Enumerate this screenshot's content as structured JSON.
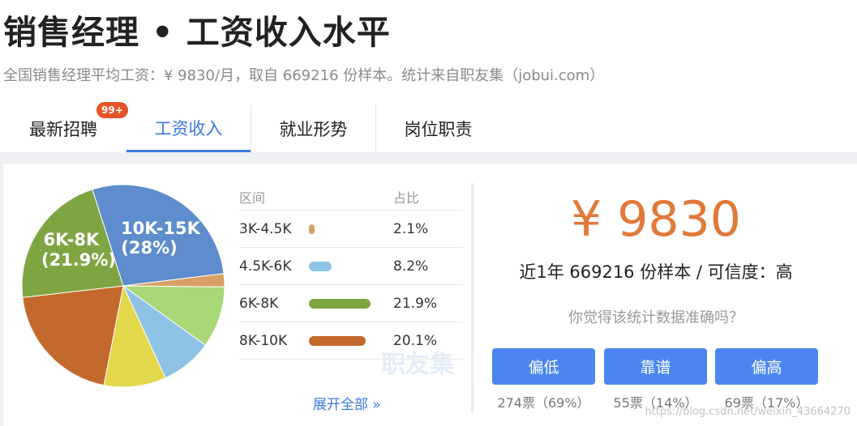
{
  "header": {
    "title": "销售经理 • 工资收入水平",
    "subtitle": "全国销售经理平均工资：¥ 9830/月，取自 669216 份样本。统计来自职友集（jobui.com）"
  },
  "tabs": [
    {
      "label": "最新招聘",
      "badge": "99+"
    },
    {
      "label": "工资收入",
      "active": true
    },
    {
      "label": "就业形势"
    },
    {
      "label": "岗位职责"
    }
  ],
  "distribution": {
    "col_range": "区间",
    "col_share": "占比",
    "rows": [
      {
        "range": "3K-4.5K",
        "percent": "2.1%",
        "share": 2.1,
        "color": "#d9a066"
      },
      {
        "range": "4.5K-6K",
        "percent": "8.2%",
        "share": 8.2,
        "color": "#8ec3e6"
      },
      {
        "range": "6K-8K",
        "percent": "21.9%",
        "share": 21.9,
        "color": "#7fa543"
      },
      {
        "range": "8K-10K",
        "percent": "20.1%",
        "share": 20.1,
        "color": "#c4692d"
      }
    ],
    "expand_label": "展开全部 »",
    "watermark": "职友集"
  },
  "pie": {
    "slices": [
      {
        "percent": 28,
        "color": "#5e8ccc"
      },
      {
        "percent": 2.1,
        "color": "#d9a066"
      },
      {
        "percent": 9.8,
        "color": "#a8d878"
      },
      {
        "percent": 8.2,
        "color": "#8ec3e6"
      },
      {
        "percent": 9.9,
        "color": "#e3d84a"
      },
      {
        "percent": 20.1,
        "color": "#c4692d"
      },
      {
        "percent": 21.9,
        "color": "#7fa543"
      }
    ],
    "label_big_name": "10K-15K",
    "label_big_pct": "(28%)",
    "label_mid_name": "6K-8K",
    "label_mid_pct": "(21.9%)"
  },
  "summary": {
    "salary": "¥ 9830",
    "samples": "近1年 669216 份样本 / 可信度：高",
    "question": "你觉得该统计数据准确吗？"
  },
  "votes": [
    {
      "label": "偏低",
      "count": "274票（69%）"
    },
    {
      "label": "靠谱",
      "count": "55票（14%）"
    },
    {
      "label": "偏高",
      "count": "69票（17%）"
    }
  ],
  "footer_watermark": "https://blog.csdn.net/weixin_43664270"
}
